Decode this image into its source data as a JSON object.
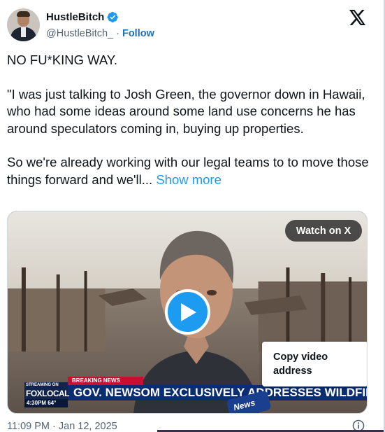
{
  "user": {
    "display_name": "HustleBitch",
    "handle": "@HustleBitch_",
    "separator": "·",
    "follow_label": "Follow",
    "verified_color": "#1d9bf0"
  },
  "tweet": {
    "paragraphs": [
      "NO FU*KING WAY.",
      "\"I was just talking to Josh Green, the governor down in Hawaii, who had some ideas around some land use concerns he has around speculators coming in, buying up properties."
    ],
    "last_paragraph": "So we're already working with our legal teams to to move those things forward and we'll...",
    "show_more_label": "Show more"
  },
  "media": {
    "watch_label": "Watch on X",
    "context_menu_item": "Copy video address",
    "breaking_news": "BREAKING NEWS",
    "headline": "GOV. NEWSOM EXCLUSIVELY ADDRESSES WILDFIRES",
    "network_streaming": "STREAMING ON",
    "network_brand": "FOXLOCAL",
    "broadcast_time": "4:30PM 64°",
    "mic_flag": "News"
  },
  "footer": {
    "timestamp": "11:09 PM · Jan 12, 2025"
  },
  "icons": {
    "brand": "x-logo-icon",
    "verified": "verified-badge-icon",
    "play": "play-icon",
    "info": "info-icon"
  },
  "colors": {
    "accent": "#1d9bf0",
    "follow": "#1d6fb8",
    "muted": "#536471"
  }
}
